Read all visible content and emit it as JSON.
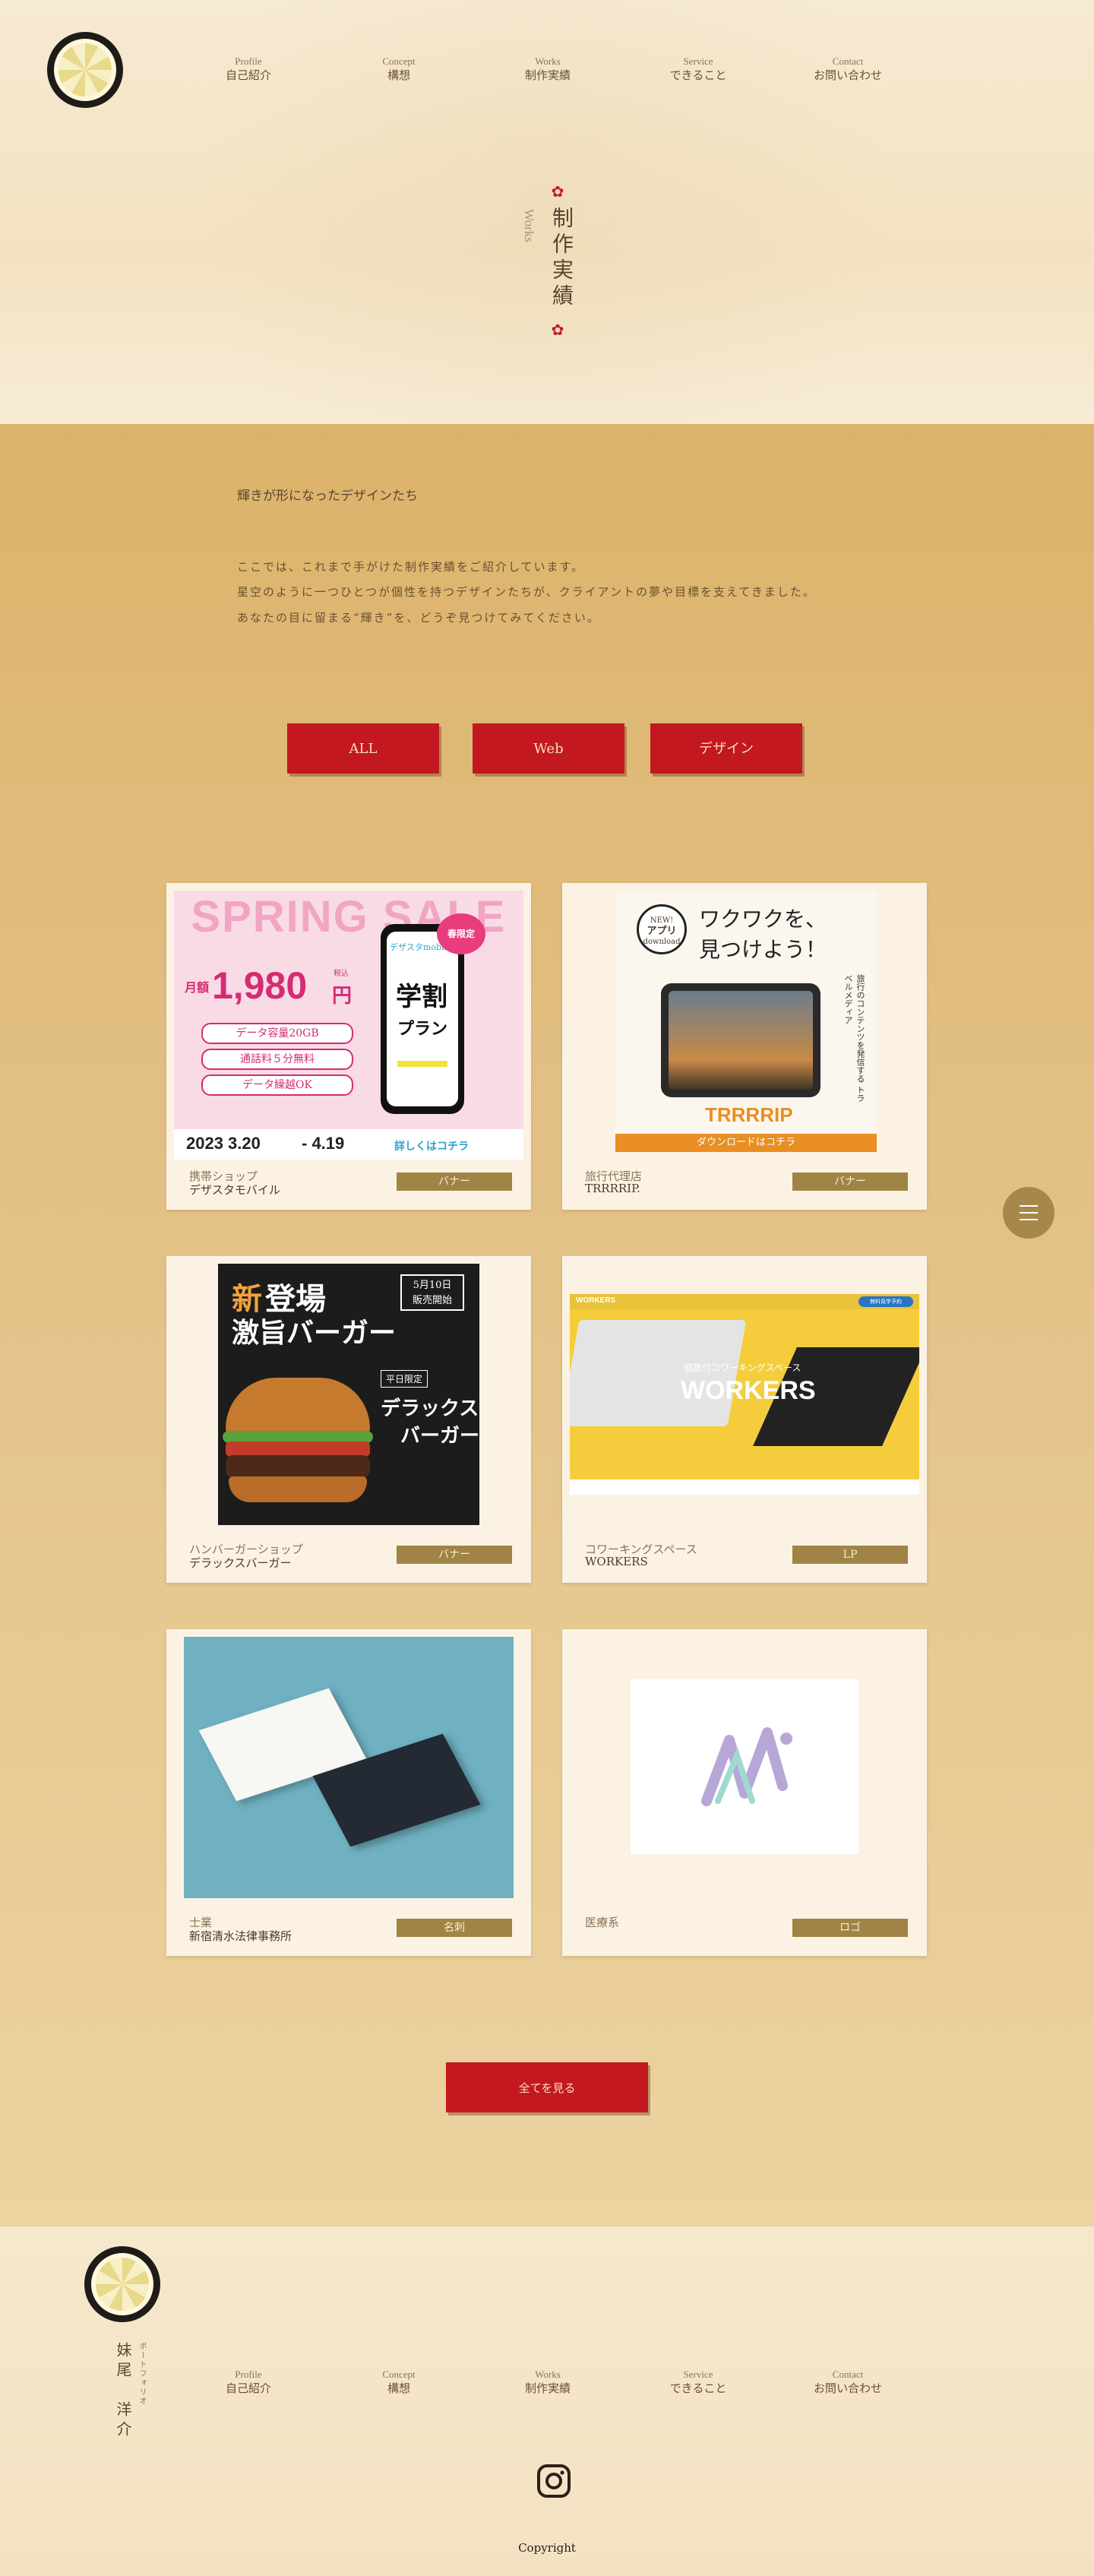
{
  "nav": [
    {
      "en": "Profile",
      "jp": "自己紹介"
    },
    {
      "en": "Concept",
      "jp": "構想"
    },
    {
      "en": "Works",
      "jp": "制作実績"
    },
    {
      "en": "Service",
      "jp": "できること"
    },
    {
      "en": "Contact",
      "jp": "お問い合わせ"
    }
  ],
  "hero": {
    "en": "Works",
    "jp": "制作実績"
  },
  "intro": {
    "tagline": "輝きが形になったデザインたち",
    "lines": [
      "ここでは、これまで手がけた制作実績をご紹介しています。",
      "星空のように一つひとつが個性を持つデザインたちが、クライアントの夢や目標を支えてきました。",
      "あなたの目に留まる“輝き”を、どうぞ見つけてみてください。"
    ]
  },
  "filters": [
    "ALL",
    "Web",
    "デザイン"
  ],
  "works": [
    {
      "category": "携帯ショップ",
      "title": "デザスタモバイル",
      "tag": "バナー",
      "banner": {
        "sale": "SPRING SALE",
        "label": "月額",
        "price": "1,980",
        "yen": "円",
        "tax": "税込",
        "features": [
          "データ容量20GB",
          "通話料５分無料",
          "データ繰越OK"
        ],
        "brand": "デザスタmobile",
        "plan1": "学割",
        "plan2": "プラン",
        "limited": "春限定",
        "dates": "2023 3.20",
        "dates2": "- 4.19",
        "cta": "詳しくはコチラ"
      }
    },
    {
      "category": "旅行代理店",
      "title": "TRRRRIP.",
      "tag": "バナー",
      "banner": {
        "headline1": "ワクワクを、",
        "headline2": "見つけよう！",
        "badge1": "NEW!",
        "badge2": "アプリ",
        "badge3": "download",
        "side": "旅行のコンテンツを発信する トラベルメディア",
        "logo": "TRRRRIP",
        "cta": "ダウンロードはコチラ"
      }
    },
    {
      "category": "ハンバーガーショップ",
      "title": "デラックスバーガー",
      "tag": "バナー",
      "banner": {
        "new": "新",
        "l1": "登場",
        "l2": "激旨バーガー",
        "release1": "5月10日",
        "release2": "販売開始",
        "limited": "平日限定",
        "name1": "デラックス",
        "name2": "バーガー"
      }
    },
    {
      "category": "コワーキングスペース",
      "title": "WORKERS",
      "tag": "LP",
      "banner": {
        "logo": "WORKERS",
        "sub": "個室付コワーキングスペース",
        "big": "WORKERS",
        "nav_button": "無料見学予約"
      }
    },
    {
      "category": "士業",
      "title": "新宿清水法律事務所",
      "tag": "名刺",
      "banner": {}
    },
    {
      "category": "医療系",
      "title": "",
      "tag": "ロゴ",
      "banner": {}
    }
  ],
  "more_button": "全てを見る",
  "footer": {
    "name": "妹尾　洋介",
    "kana": "ポートフォリオ",
    "copyright": "Copyright"
  },
  "colors": {
    "accent": "#c41820",
    "tag": "#a08445",
    "menu": "#a8874a"
  }
}
